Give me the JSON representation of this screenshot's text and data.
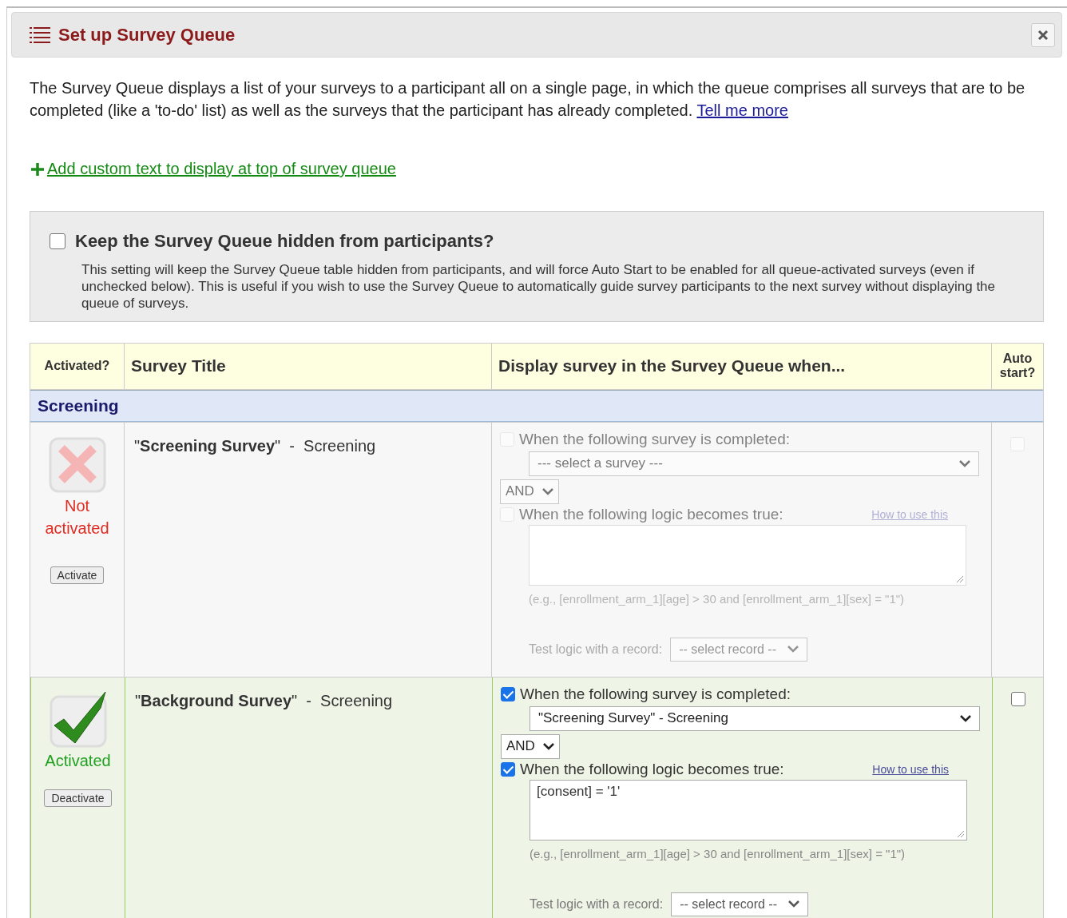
{
  "panel": {
    "title": "Set up Survey Queue"
  },
  "intro": {
    "text": "The Survey Queue displays a list of your surveys to a participant all on a single page, in which the queue comprises all surveys that are to be completed (like a 'to-do' list) as well as the surveys that the participant has already completed.",
    "link": "Tell me more"
  },
  "add_custom_text_link": "Add custom text to display at top of survey queue",
  "hide_option": {
    "checked": false,
    "label": "Keep the Survey Queue hidden from participants?",
    "description": "This setting will keep the Survey Queue table hidden from participants, and will force Auto Start to be enabled for all queue-activated surveys (even if unchecked below). This is useful if you wish to use the Survey Queue to automatically guide survey participants to the next survey without displaying the queue of surveys."
  },
  "table": {
    "columns": [
      "Activated?",
      "Survey Title",
      "Display survey in the Survey Queue when...",
      "Auto start?"
    ],
    "groups": [
      {
        "name": "Screening",
        "rows": [
          {
            "activated": false,
            "status": "Not activated",
            "button": "Activate",
            "title": "\"**Screening Survey**\"  -  Screening",
            "survey_condition": {
              "checked": false,
              "label": "When the following survey is completed:",
              "select": "--- select a survey ---"
            },
            "operator": "AND",
            "logic_condition": {
              "checked": false,
              "label": "When the following logic becomes true:",
              "help_link": "How to use this"
            },
            "example": "(e.g., [enrollment_arm_1][age] > 30 and [enrollment_arm_1][sex] = \"1\")",
            "test_label": "Test logic with a record:",
            "record_select": "-- select record --",
            "auto_start": false
          },
          {
            "activated": true,
            "status": "Activated",
            "button": "Deactivate",
            "title": "\"**Background Survey**\"  -  Screening",
            "survey_condition": {
              "checked": true,
              "label": "When the following survey is completed:",
              "select": "\"Screening Survey\" - Screening"
            },
            "operator": "AND",
            "logic_condition": {
              "checked": true,
              "label": "When the following logic becomes true:",
              "help_link": "How to use this",
              "value": "[consent] = '1'"
            },
            "example": "(e.g., [enrollment_arm_1][age] > 30 and [enrollment_arm_1][sex] = \"1\")",
            "test_label": "Test logic with a record:",
            "record_select": "-- select record --",
            "auto_start": false
          }
        ]
      }
    ]
  }
}
